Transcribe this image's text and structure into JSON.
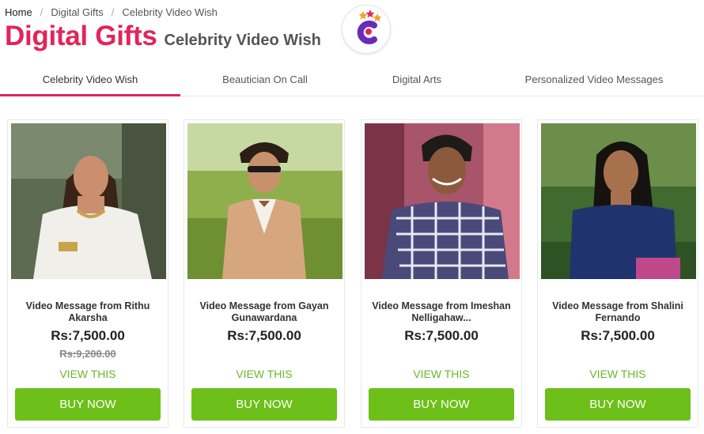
{
  "breadcrumb": {
    "items": [
      "Home",
      "Digital Gifts",
      "Celebrity Video Wish"
    ],
    "separator": "/"
  },
  "heading": {
    "title": "Digital Gifts",
    "subtitle": "Celebrity Video Wish"
  },
  "logo": {
    "icon": "star-c-logo-icon",
    "colors": [
      "#6b2ab8",
      "#e3245a",
      "#f2a21f"
    ]
  },
  "tabs": [
    {
      "label": "Celebrity Video Wish",
      "active": true
    },
    {
      "label": "Beautician On Call",
      "active": false
    },
    {
      "label": "Digital Arts",
      "active": false
    },
    {
      "label": "Personalized Video Messages",
      "active": false
    }
  ],
  "products": [
    {
      "title": "Video Message from Rithu Akarsha",
      "price": "Rs:7,500.00",
      "old_price": "Rs:9,200.00",
      "view_label": "VIEW THIS",
      "buy_label": "BUY NOW",
      "photo": "woman-in-white-dress-photo"
    },
    {
      "title": "Video Message from Gayan Gunawardana",
      "price": "Rs:7,500.00",
      "old_price": "",
      "view_label": "VIEW THIS",
      "buy_label": "BUY NOW",
      "photo": "man-in-tan-suit-photo"
    },
    {
      "title": "Video Message from Imeshan Nelligahaw...",
      "price": "Rs:7,500.00",
      "old_price": "",
      "view_label": "VIEW THIS",
      "buy_label": "BUY NOW",
      "photo": "man-in-plaid-shirt-photo"
    },
    {
      "title": "Video Message from Shalini Fernando",
      "price": "Rs:7,500.00",
      "old_price": "",
      "view_label": "VIEW THIS",
      "buy_label": "BUY NOW",
      "photo": "woman-in-blue-top-photo"
    }
  ],
  "colors": {
    "accent": "#e3245a",
    "buy_button": "#6cc019",
    "view_link": "#6cb52d"
  }
}
